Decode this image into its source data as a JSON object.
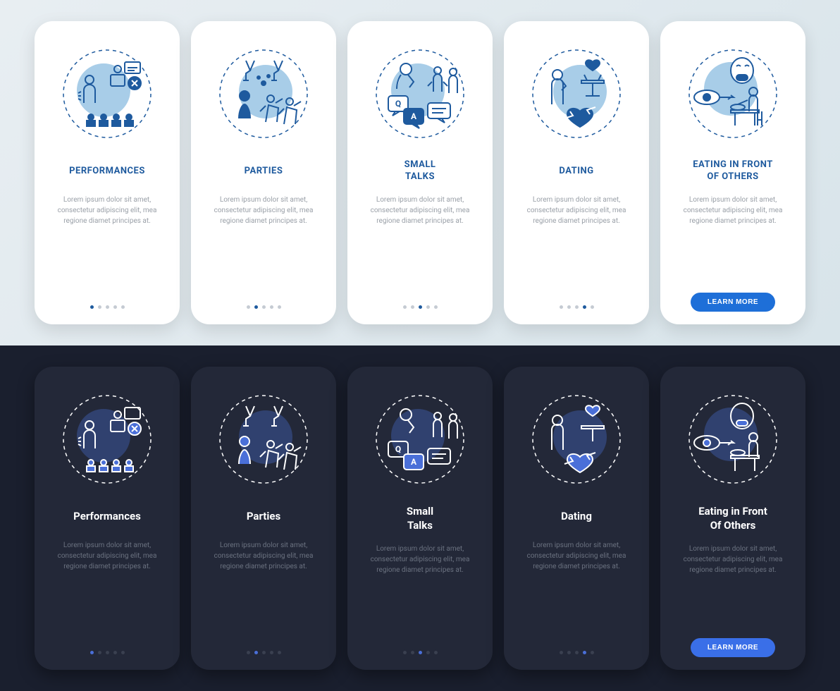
{
  "colors": {
    "light_accent": "#1e5a9e",
    "light_fill": "#a8cde8",
    "dark_accent": "#4a6fd8",
    "button": "#1e6fd8"
  },
  "copy": {
    "desc": "Lorem ipsum dolor sit amet, consectetur adipiscing elit, mea regione diamet principes at.",
    "cta": "LEARN MORE"
  },
  "light": {
    "cards": [
      {
        "title": "PERFORMANCES",
        "icon": "performances",
        "active_dot": 0
      },
      {
        "title": "PARTIES",
        "icon": "parties",
        "active_dot": 1
      },
      {
        "title": "SMALL\nTALKS",
        "icon": "small-talks",
        "active_dot": 2
      },
      {
        "title": "DATING",
        "icon": "dating",
        "active_dot": 3
      },
      {
        "title": "EATING IN FRONT\nOF OTHERS",
        "icon": "eating",
        "active_dot": 4,
        "cta": true
      }
    ]
  },
  "dark": {
    "cards": [
      {
        "title": "Performances",
        "icon": "performances",
        "active_dot": 0
      },
      {
        "title": "Parties",
        "icon": "parties",
        "active_dot": 1
      },
      {
        "title": "Small\nTalks",
        "icon": "small-talks",
        "active_dot": 2
      },
      {
        "title": "Dating",
        "icon": "dating",
        "active_dot": 3
      },
      {
        "title": "Eating in Front\nOf Others",
        "icon": "eating",
        "active_dot": 4,
        "cta": true
      }
    ]
  }
}
